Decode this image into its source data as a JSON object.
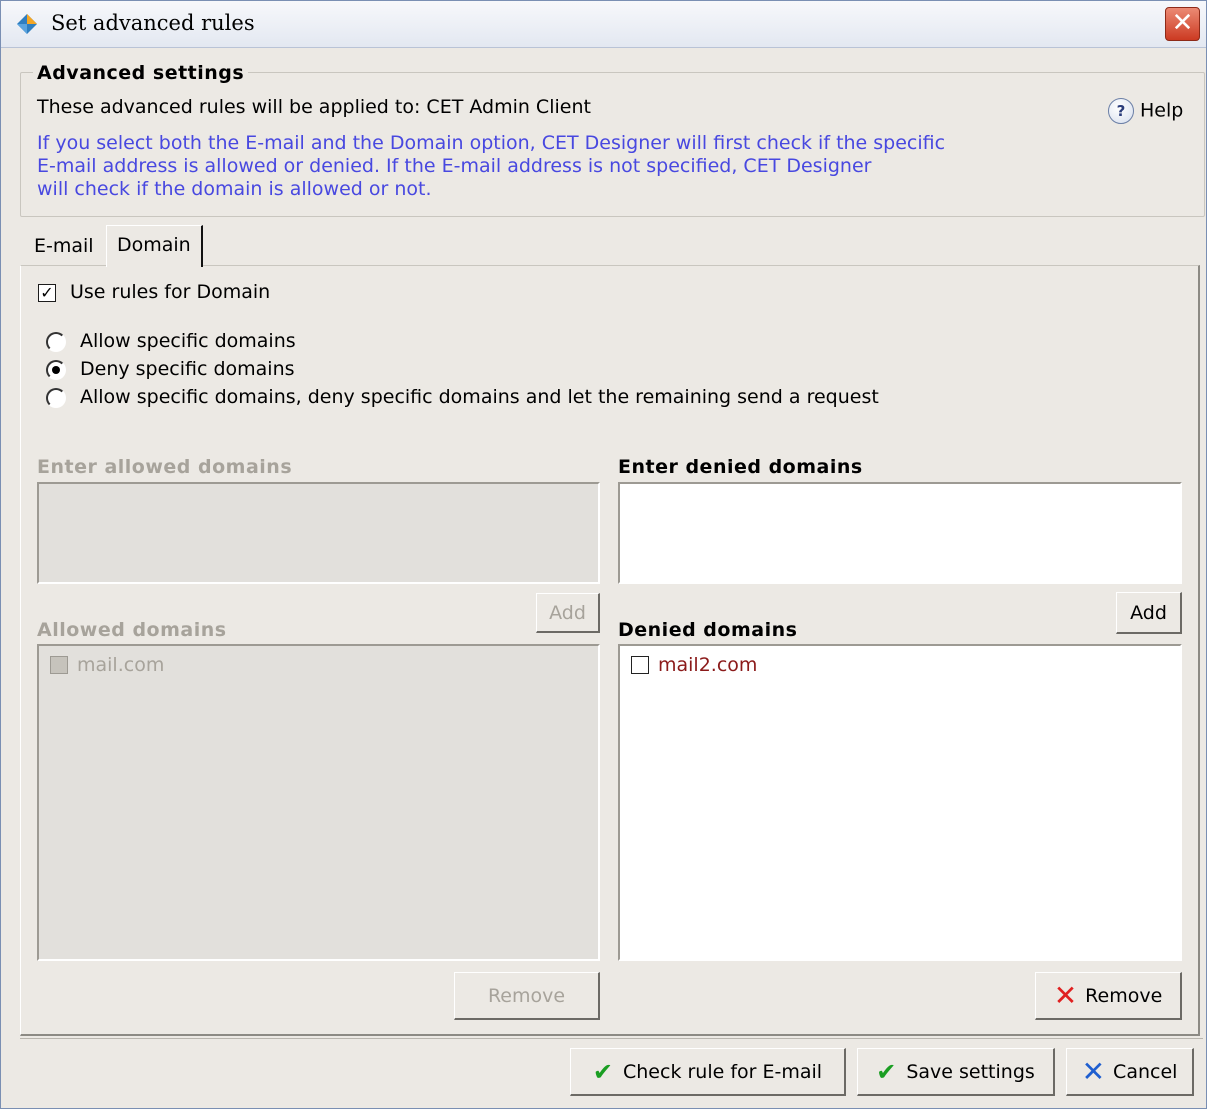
{
  "window": {
    "title": "Set advanced rules",
    "icon": "app-diamond-icon",
    "close_icon": "close-icon"
  },
  "advanced": {
    "legend": "Advanced settings",
    "applied_text": "These advanced rules will be applied to: CET Admin Client",
    "help_label": "Help",
    "help_icon": "help-question-icon",
    "info_lines": [
      "If you select both the E-mail and the Domain option, CET Designer will first check if the specific",
      "E-mail address is allowed or denied. If the E-mail address is not specified, CET Designer",
      "will check if the domain is allowed or not."
    ],
    "info_color": "#4848e0"
  },
  "tabs": [
    {
      "label": "E-mail",
      "active": false
    },
    {
      "label": "Domain",
      "active": true
    }
  ],
  "domain_panel": {
    "use_rules_label": "Use rules for Domain",
    "use_rules_checked": true,
    "radio_options": [
      {
        "label": "Allow specific domains",
        "selected": false
      },
      {
        "label": "Deny specific domains",
        "selected": true
      },
      {
        "label": "Allow specific domains, deny specific domains and let the remaining send a request",
        "selected": false
      }
    ],
    "allowed": {
      "enter_heading": "Enter allowed domains",
      "input_value": "",
      "add_label": "Add",
      "list_heading": "Allowed domains",
      "items": [
        "mail.com"
      ],
      "remove_label": "Remove",
      "enabled": false
    },
    "denied": {
      "enter_heading": "Enter denied domains",
      "input_value": "",
      "add_label": "Add",
      "list_heading": "Denied domains",
      "items": [
        "mail2.com"
      ],
      "item_color": "#8b1a1a",
      "remove_label": "Remove",
      "remove_icon": "red-x-icon",
      "enabled": true
    }
  },
  "footer": {
    "check_rule_label": "Check rule for E-mail",
    "save_label": "Save settings",
    "cancel_label": "Cancel",
    "check_icon": "green-check-icon",
    "cancel_icon": "blue-x-icon"
  }
}
